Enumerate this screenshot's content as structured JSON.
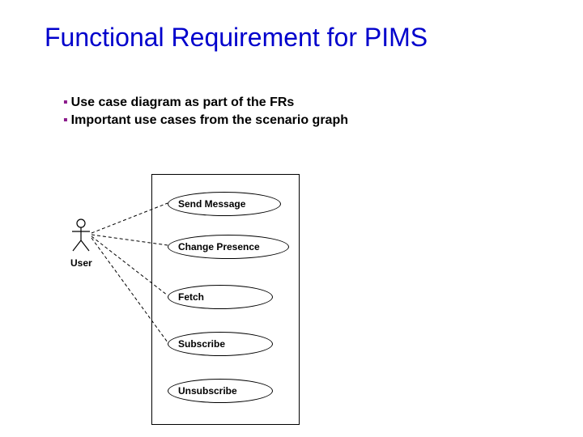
{
  "title": "Functional Requirement for PIMS",
  "bullets": {
    "b1": "Use case diagram as part of the FRs",
    "b2": "Important use cases from the scenario graph"
  },
  "actor": {
    "label": "User"
  },
  "usecases": {
    "uc1": "Send Message",
    "uc2": "Change Presence",
    "uc3": "Fetch",
    "uc4": "Subscribe",
    "uc5": "Unsubscribe"
  }
}
